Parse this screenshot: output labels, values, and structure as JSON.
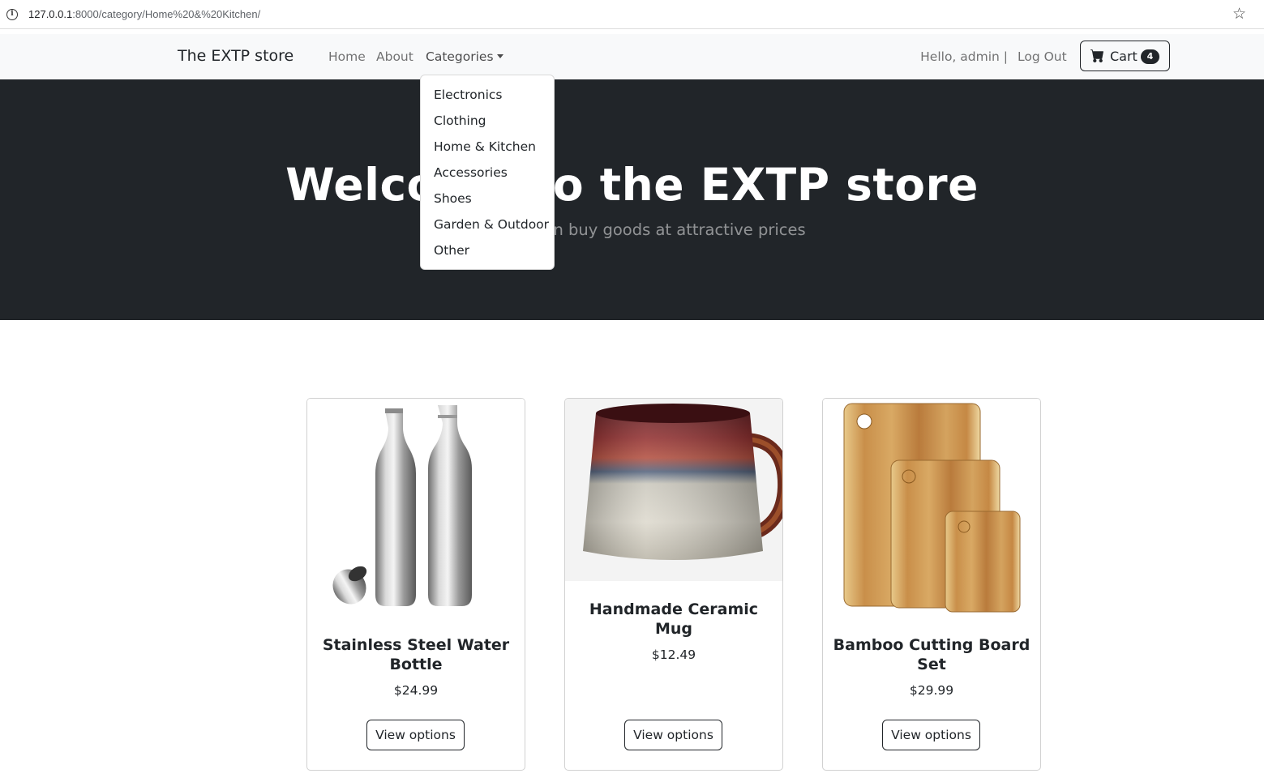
{
  "browser": {
    "url_host": "127.0.0.1",
    "url_path": ":8000/category/Home%20&%20Kitchen/"
  },
  "navbar": {
    "brand": "The EXTP store",
    "links": {
      "home": "Home",
      "about": "About",
      "categories": "Categories"
    },
    "greeting": "Hello, admin |",
    "logout": "Log Out",
    "cart_label": "Cart",
    "cart_count": "4"
  },
  "categories_menu": [
    "Electronics",
    "Clothing",
    "Home & Kitchen",
    "Accessories",
    "Shoes",
    "Garden & Outdoor",
    "Other"
  ],
  "hero": {
    "title": "Welcome to the EXTP store",
    "subtitle": "Here you can buy goods at attractive prices"
  },
  "products": [
    {
      "name": "Stainless Steel Water Bottle",
      "price": "$24.99",
      "button": "View options",
      "image": "steel-bottles"
    },
    {
      "name": "Handmade Ceramic Mug",
      "price": "$12.49",
      "button": "View options",
      "image": "ceramic-mug"
    },
    {
      "name": "Bamboo Cutting Board Set",
      "price": "$29.99",
      "button": "View options",
      "image": "cutting-boards"
    }
  ],
  "colors": {
    "dark": "#212529",
    "navbar_bg": "#f8f9fa"
  }
}
